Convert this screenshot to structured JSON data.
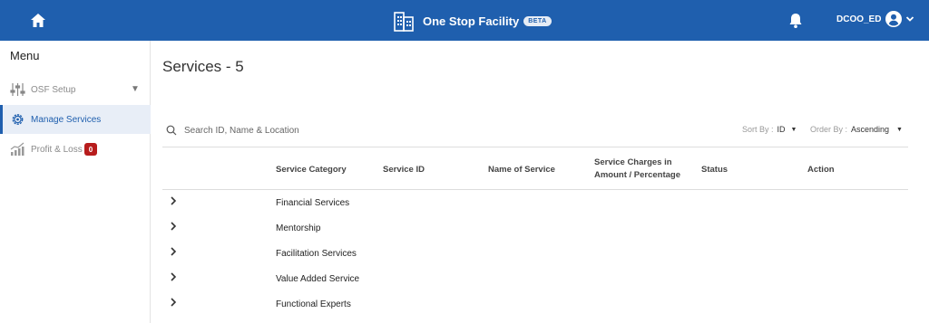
{
  "header": {
    "app_title": "One Stop Facility",
    "beta_label": "BETA",
    "user_name": "DCOO_ED",
    "icons": {
      "home": "home-icon",
      "logo": "buildings-icon",
      "notifications": "bell-icon",
      "avatar": "account-circle-icon",
      "menu": "chevron-down-icon"
    },
    "colors": {
      "bar": "#1f5fae"
    }
  },
  "sidebar": {
    "title": "Menu",
    "items": [
      {
        "label": "OSF Setup",
        "icon": "sliders-icon",
        "active": false,
        "expandable": true
      },
      {
        "label": "Manage Services",
        "icon": "gear-icon",
        "active": true
      },
      {
        "label": "Profit & Loss",
        "icon": "chart-icon",
        "active": false,
        "badge": "0"
      }
    ]
  },
  "main": {
    "title": "Services - 5",
    "search": {
      "placeholder": "Search ID, Name & Location",
      "value": ""
    },
    "sort": {
      "label": "Sort By :",
      "value": "ID"
    },
    "order": {
      "label": "Order By :",
      "value": "Ascending"
    },
    "table": {
      "columns": [
        "Service Category",
        "Service ID",
        "Name of Service",
        "Service Charges in",
        "Amount / Percentage",
        "Status",
        "Action"
      ],
      "rows": [
        {
          "category": "Financial Services"
        },
        {
          "category": "Mentorship"
        },
        {
          "category": "Facilitation Services"
        },
        {
          "category": "Value Added Service"
        },
        {
          "category": "Functional Experts"
        }
      ]
    }
  }
}
